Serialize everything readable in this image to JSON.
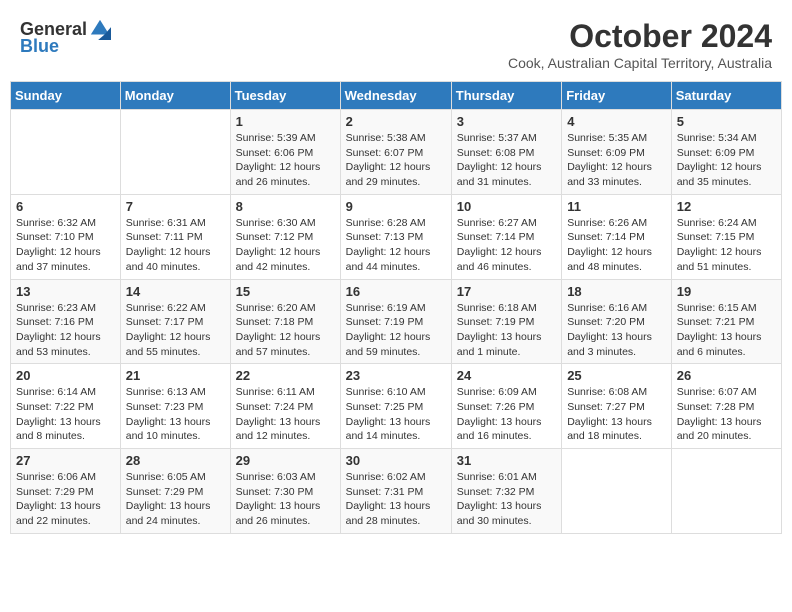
{
  "header": {
    "logo_general": "General",
    "logo_blue": "Blue",
    "month_title": "October 2024",
    "location": "Cook, Australian Capital Territory, Australia"
  },
  "days_of_week": [
    "Sunday",
    "Monday",
    "Tuesday",
    "Wednesday",
    "Thursday",
    "Friday",
    "Saturday"
  ],
  "weeks": [
    [
      {
        "day": "",
        "info": ""
      },
      {
        "day": "",
        "info": ""
      },
      {
        "day": "1",
        "info": "Sunrise: 5:39 AM\nSunset: 6:06 PM\nDaylight: 12 hours and 26 minutes."
      },
      {
        "day": "2",
        "info": "Sunrise: 5:38 AM\nSunset: 6:07 PM\nDaylight: 12 hours and 29 minutes."
      },
      {
        "day": "3",
        "info": "Sunrise: 5:37 AM\nSunset: 6:08 PM\nDaylight: 12 hours and 31 minutes."
      },
      {
        "day": "4",
        "info": "Sunrise: 5:35 AM\nSunset: 6:09 PM\nDaylight: 12 hours and 33 minutes."
      },
      {
        "day": "5",
        "info": "Sunrise: 5:34 AM\nSunset: 6:09 PM\nDaylight: 12 hours and 35 minutes."
      }
    ],
    [
      {
        "day": "6",
        "info": "Sunrise: 6:32 AM\nSunset: 7:10 PM\nDaylight: 12 hours and 37 minutes."
      },
      {
        "day": "7",
        "info": "Sunrise: 6:31 AM\nSunset: 7:11 PM\nDaylight: 12 hours and 40 minutes."
      },
      {
        "day": "8",
        "info": "Sunrise: 6:30 AM\nSunset: 7:12 PM\nDaylight: 12 hours and 42 minutes."
      },
      {
        "day": "9",
        "info": "Sunrise: 6:28 AM\nSunset: 7:13 PM\nDaylight: 12 hours and 44 minutes."
      },
      {
        "day": "10",
        "info": "Sunrise: 6:27 AM\nSunset: 7:14 PM\nDaylight: 12 hours and 46 minutes."
      },
      {
        "day": "11",
        "info": "Sunrise: 6:26 AM\nSunset: 7:14 PM\nDaylight: 12 hours and 48 minutes."
      },
      {
        "day": "12",
        "info": "Sunrise: 6:24 AM\nSunset: 7:15 PM\nDaylight: 12 hours and 51 minutes."
      }
    ],
    [
      {
        "day": "13",
        "info": "Sunrise: 6:23 AM\nSunset: 7:16 PM\nDaylight: 12 hours and 53 minutes."
      },
      {
        "day": "14",
        "info": "Sunrise: 6:22 AM\nSunset: 7:17 PM\nDaylight: 12 hours and 55 minutes."
      },
      {
        "day": "15",
        "info": "Sunrise: 6:20 AM\nSunset: 7:18 PM\nDaylight: 12 hours and 57 minutes."
      },
      {
        "day": "16",
        "info": "Sunrise: 6:19 AM\nSunset: 7:19 PM\nDaylight: 12 hours and 59 minutes."
      },
      {
        "day": "17",
        "info": "Sunrise: 6:18 AM\nSunset: 7:19 PM\nDaylight: 13 hours and 1 minute."
      },
      {
        "day": "18",
        "info": "Sunrise: 6:16 AM\nSunset: 7:20 PM\nDaylight: 13 hours and 3 minutes."
      },
      {
        "day": "19",
        "info": "Sunrise: 6:15 AM\nSunset: 7:21 PM\nDaylight: 13 hours and 6 minutes."
      }
    ],
    [
      {
        "day": "20",
        "info": "Sunrise: 6:14 AM\nSunset: 7:22 PM\nDaylight: 13 hours and 8 minutes."
      },
      {
        "day": "21",
        "info": "Sunrise: 6:13 AM\nSunset: 7:23 PM\nDaylight: 13 hours and 10 minutes."
      },
      {
        "day": "22",
        "info": "Sunrise: 6:11 AM\nSunset: 7:24 PM\nDaylight: 13 hours and 12 minutes."
      },
      {
        "day": "23",
        "info": "Sunrise: 6:10 AM\nSunset: 7:25 PM\nDaylight: 13 hours and 14 minutes."
      },
      {
        "day": "24",
        "info": "Sunrise: 6:09 AM\nSunset: 7:26 PM\nDaylight: 13 hours and 16 minutes."
      },
      {
        "day": "25",
        "info": "Sunrise: 6:08 AM\nSunset: 7:27 PM\nDaylight: 13 hours and 18 minutes."
      },
      {
        "day": "26",
        "info": "Sunrise: 6:07 AM\nSunset: 7:28 PM\nDaylight: 13 hours and 20 minutes."
      }
    ],
    [
      {
        "day": "27",
        "info": "Sunrise: 6:06 AM\nSunset: 7:29 PM\nDaylight: 13 hours and 22 minutes."
      },
      {
        "day": "28",
        "info": "Sunrise: 6:05 AM\nSunset: 7:29 PM\nDaylight: 13 hours and 24 minutes."
      },
      {
        "day": "29",
        "info": "Sunrise: 6:03 AM\nSunset: 7:30 PM\nDaylight: 13 hours and 26 minutes."
      },
      {
        "day": "30",
        "info": "Sunrise: 6:02 AM\nSunset: 7:31 PM\nDaylight: 13 hours and 28 minutes."
      },
      {
        "day": "31",
        "info": "Sunrise: 6:01 AM\nSunset: 7:32 PM\nDaylight: 13 hours and 30 minutes."
      },
      {
        "day": "",
        "info": ""
      },
      {
        "day": "",
        "info": ""
      }
    ]
  ]
}
